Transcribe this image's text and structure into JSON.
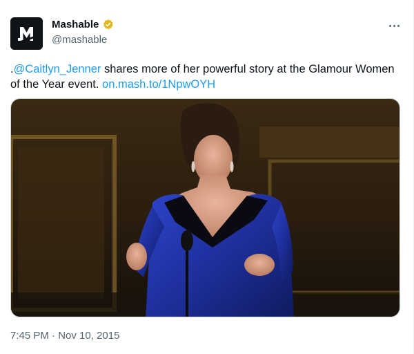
{
  "account": {
    "display_name": "Mashable",
    "handle": "@mashable",
    "avatar_letter": "M",
    "verified_badge_color": "#e2b719"
  },
  "tweet": {
    "text_prefix": ".",
    "mention": "@Caitlyn_Jenner",
    "text_body": " shares more of her powerful story at the Glamour Women of the Year event. ",
    "link": "on.mash.to/1NpwOYH",
    "timestamp": "7:45 PM · Nov 10, 2015"
  },
  "colors": {
    "link": "#1d9bf0",
    "secondary_text": "#536471",
    "dress": "#1e2f9c"
  },
  "icons": {
    "more": "more-options-icon",
    "verified": "verified-badge-icon"
  }
}
